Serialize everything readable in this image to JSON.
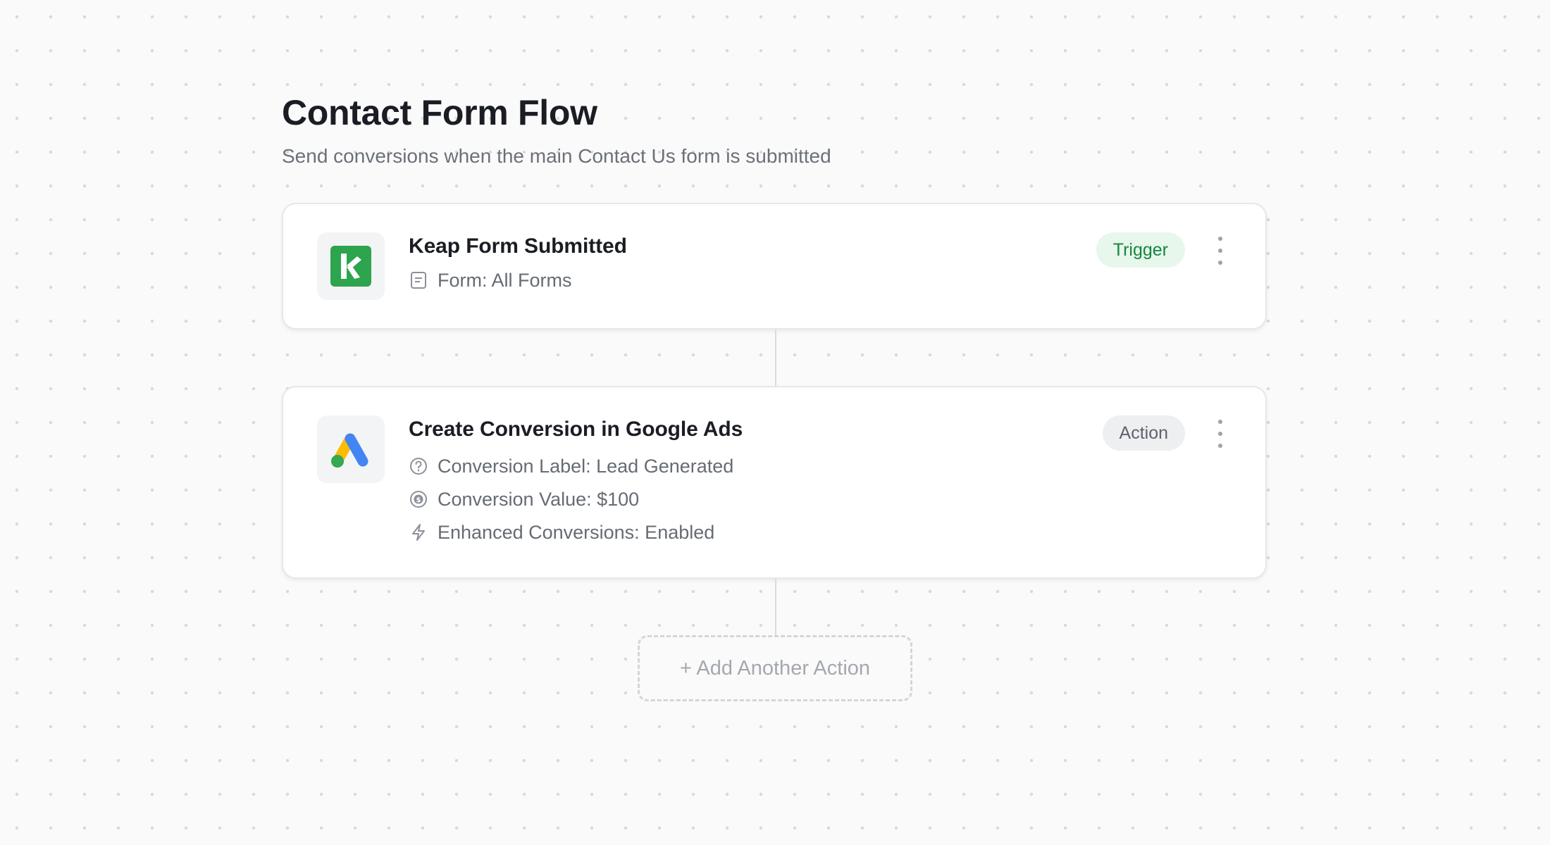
{
  "flow": {
    "title": "Contact Form Flow",
    "subtitle": "Send conversions when the main Contact Us form is submitted"
  },
  "trigger_card": {
    "title": "Keap Form Submitted",
    "logo_icon": "keap-logo-icon",
    "badge": "Trigger",
    "details": [
      {
        "icon": "form-document-icon",
        "text": "Form: All Forms"
      }
    ]
  },
  "action_card": {
    "title": "Create Conversion in Google Ads",
    "logo_icon": "google-ads-logo-icon",
    "badge": "Action",
    "details": [
      {
        "icon": "question-circle-icon",
        "text": "Conversion Label: Lead Generated"
      },
      {
        "icon": "dollar-circle-icon",
        "text": "Conversion Value: $100"
      },
      {
        "icon": "lightning-icon",
        "text": "Enhanced Conversions: Enabled"
      }
    ]
  },
  "add_action": {
    "label": "+ Add Another Action"
  },
  "colors": {
    "background": "#fafafa",
    "keap_green": "#2da44e",
    "trigger_badge_bg": "#e7f7ec",
    "trigger_badge_text": "#17843f",
    "action_badge_bg": "#eeeff1",
    "google_blue": "#4285f4",
    "google_yellow": "#fbbc04",
    "google_green": "#34a853"
  }
}
